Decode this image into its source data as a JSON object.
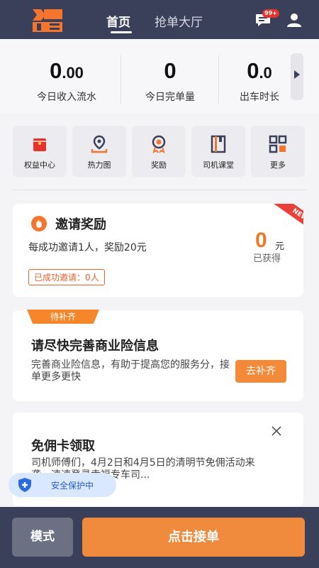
{
  "header": {
    "tabs": [
      {
        "label": "首页",
        "active": true
      },
      {
        "label": "抢单大厅",
        "active": false
      }
    ],
    "message_badge": "99+",
    "colors": {
      "bar": "#3a3f5a",
      "accent": "#f7742c"
    }
  },
  "stats": [
    {
      "value_main": "0",
      "value_decimal": ".00",
      "label": "今日收入流水"
    },
    {
      "value_main": "0",
      "value_decimal": "",
      "label": "今日完单量"
    },
    {
      "value_main": "0",
      "value_decimal": ".0",
      "label": "出车时长"
    }
  ],
  "quick_actions": [
    {
      "label": "权益中心",
      "icon": "gift-pack-icon"
    },
    {
      "label": "热力图",
      "icon": "map-pin-icon"
    },
    {
      "label": "奖励",
      "icon": "medal-icon"
    },
    {
      "label": "司机课堂",
      "icon": "book-icon"
    },
    {
      "label": "更多",
      "icon": "grid-icon"
    }
  ],
  "invite": {
    "title": "邀请奖励",
    "description": "每成功邀请1人，奖励20元",
    "count_label": "已成功邀请：0人",
    "amount": "0",
    "unit": "元",
    "earned_label": "已获得",
    "ribbon": "NEW"
  },
  "insurance": {
    "tag": "待补齐",
    "title": "请尽快完善商业险信息",
    "description": "完善商业险信息，有助于提高您的服务分，接单更多更快",
    "button": "去补齐"
  },
  "coupon": {
    "title": "免佣卡领取",
    "description": "司机师傅们，4月2日和4月5日的清明节免佣活动来袭，速速登录幸福专车司..."
  },
  "safety": {
    "label": "安全保护中"
  },
  "bottom": {
    "mode_button": "模式",
    "accept_button": "点击接单"
  }
}
